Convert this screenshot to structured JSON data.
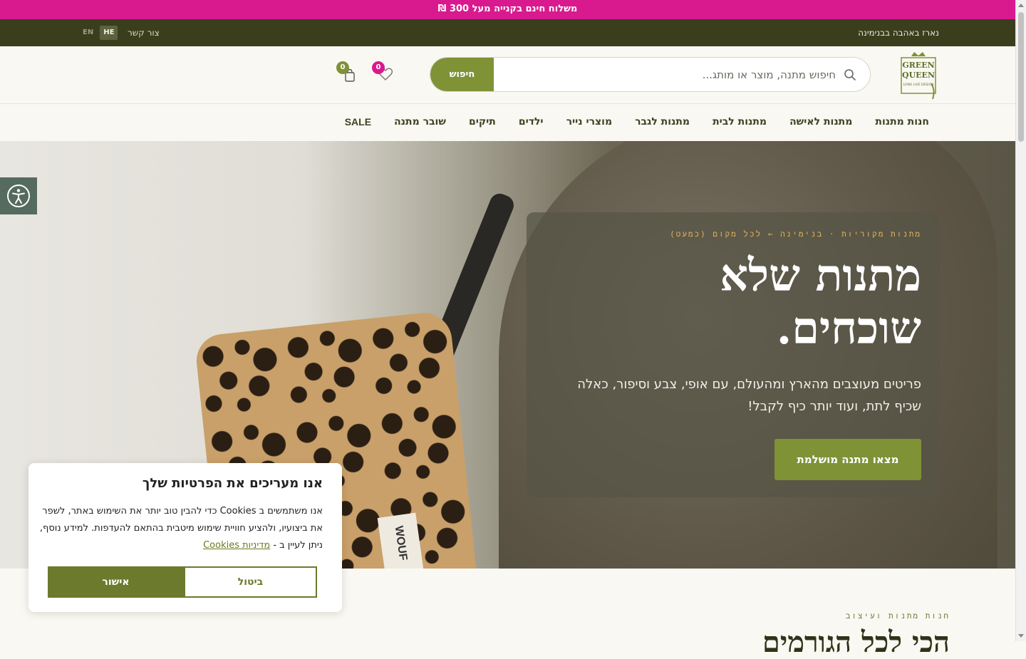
{
  "promo": {
    "text": "משלוח חינם בקנייה מעל 300 ₪"
  },
  "topbar": {
    "tagline": "נארז באהבה בבנימינה",
    "contact": "צור קשר",
    "lang_he": "HE",
    "lang_en": "EN"
  },
  "header": {
    "logo_alt": "GREEN QUEEN",
    "logo_line1": "GREEN",
    "logo_line2": "QUEEN",
    "logo_sub": "LONG LIVE DESIGN",
    "search_placeholder": "חיפוש מתנה, מוצר או מותג...",
    "search_button": "חיפוש",
    "wishlist_count": "0",
    "cart_count": "0"
  },
  "nav": {
    "items": [
      {
        "label": "חנות מתנות"
      },
      {
        "label": "מתנות לאישה"
      },
      {
        "label": "מתנות לבית"
      },
      {
        "label": "מתנות לגבר"
      },
      {
        "label": "מוצרי נייר"
      },
      {
        "label": "ילדים"
      },
      {
        "label": "תיקים"
      },
      {
        "label": "שובר מתנה"
      },
      {
        "label": "SALE"
      }
    ]
  },
  "hero": {
    "eyebrow": "מתנות מקוריות · בנימינה ← לכל מקום (כמעט)",
    "title_line1": "מתנות שלא",
    "title_line2": "שוכחים.",
    "subtitle": "פריטים מעוצבים מהארץ ומהעולם, עם אופי, צבע וסיפור, כאלה שכיף לתת, ועוד יותר כיף לקבל!",
    "cta": "מצאו מתנה מושלמת",
    "bag_label": "WOUF"
  },
  "section": {
    "eyebrow": "חנות מתנות ועיצוב",
    "title": "הכי לכל הגורמים"
  },
  "cookie": {
    "title": "אנו מעריכים את הפרטיות שלך",
    "text": "אנו משתמשים ב Cookies כדי להבין טוב יותר את השימוש באתר, לשפר את ביצועיו, ולהציע חוויית שימוש מיטבית בהתאם להעדפות. למידע נוסף, ניתן לעיין ב -",
    "policy_link": "מדיניות Cookies",
    "approve": "אישור",
    "cancel": "ביטול"
  },
  "colors": {
    "promo": "#d91a8f",
    "topbar": "#3a3e1d",
    "accent_green": "#7f9236",
    "cookie_green": "#6b7a2c",
    "eyebrow_gold": "#e3b45a"
  }
}
